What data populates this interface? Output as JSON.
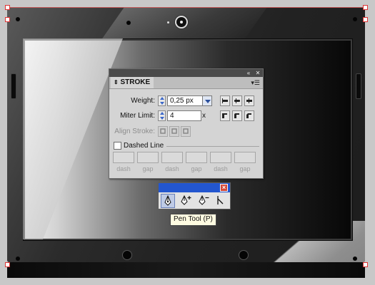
{
  "stroke_panel": {
    "tab_label": "STROKE",
    "weight": {
      "label": "Weight:",
      "value": "0,25 px"
    },
    "miter_limit": {
      "label": "Miter Limit:",
      "value": "4",
      "suffix": "x"
    },
    "align_stroke": {
      "label": "Align Stroke:"
    },
    "dashed_line": {
      "label": "Dashed Line",
      "checked": false
    },
    "dash_fields": [
      {
        "label": "dash"
      },
      {
        "label": "gap"
      },
      {
        "label": "dash"
      },
      {
        "label": "gap"
      },
      {
        "label": "dash"
      },
      {
        "label": "gap"
      }
    ]
  },
  "pen_tool_panel": {
    "close_glyph": "×",
    "tools": [
      {
        "icon": "pen-icon",
        "active": true
      },
      {
        "icon": "add-anchor-point-icon",
        "active": false
      },
      {
        "icon": "delete-anchor-point-icon",
        "active": false
      },
      {
        "icon": "convert-anchor-point-icon",
        "active": false
      }
    ],
    "tooltip": "Pen Tool (P)"
  },
  "colors": {
    "title_blue": "#2356cf",
    "spinner_blue": "#3a66c8",
    "close_red": "#d64a3a",
    "selection_red": "#d33333"
  }
}
